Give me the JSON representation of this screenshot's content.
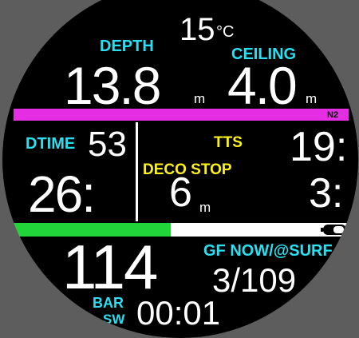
{
  "top": {
    "temperature_value": "15",
    "temperature_unit": "°C"
  },
  "depth": {
    "label": "DEPTH",
    "value": "13.8",
    "unit": "m"
  },
  "ceiling": {
    "label": "CEILING",
    "value": "4.0",
    "unit": "m"
  },
  "gas_bar": {
    "label": "N2",
    "color": "#e52ee3"
  },
  "dive_time": {
    "label": "DTIME",
    "value_minutes": "53",
    "value_seconds": "26:"
  },
  "tts": {
    "label": "TTS",
    "value_top": "19:",
    "value_bottom": "3:"
  },
  "deco_stop": {
    "label": "DECO STOP",
    "depth_value": "6",
    "depth_unit": "m"
  },
  "progress_bar": {
    "fill_fraction": 0.47,
    "color": "#21d43a"
  },
  "battery_icon": "battery-icon",
  "pressure": {
    "value": "114",
    "unit": "BAR"
  },
  "gradient_factor": {
    "label": "GF NOW/@SURF",
    "value": "3/109"
  },
  "footer": {
    "mode": "SW",
    "time": "00:01"
  },
  "colors": {
    "cyan": "#29e0f2",
    "yellow": "#fff21a",
    "magenta": "#e52ee3",
    "green": "#21d43a"
  }
}
